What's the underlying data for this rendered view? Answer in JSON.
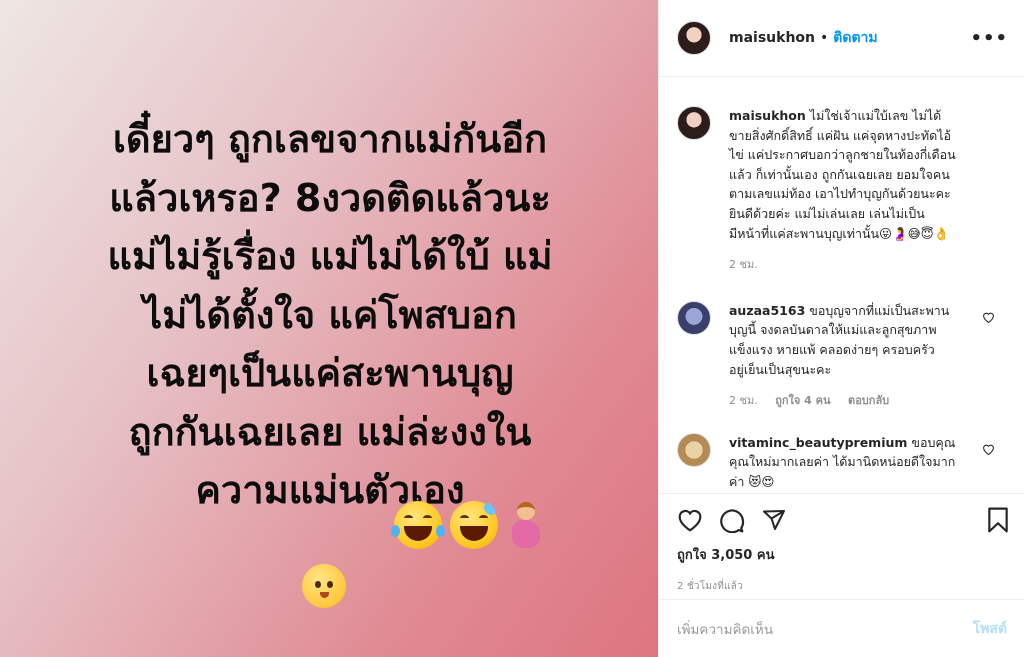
{
  "image": {
    "text": "เดี๋ยวๆ ถูกเลขจากแม่กันอีก\nแล้วเหรอ? 8งวดติดแล้วนะ\nแม่ไม่รู้เรื่อง แม่ไม่ได้ใบ้ แม่\nไม่ได้ตั้งใจ แค่โพสบอก\nเฉยๆเป็นแค่สะพานบุญ\nถูกกันเฉยเลย แม่ล่ะงงใน\nความแม่นตัวเอง",
    "emojis": [
      "face-with-tears-of-joy",
      "grinning-face-with-sweat",
      "pregnant-woman",
      "baby"
    ]
  },
  "header": {
    "username": "maisukhon",
    "separator": "•",
    "follow_label": "ติดตาม",
    "more_icon": "more-icon",
    "more_label": "•••"
  },
  "comments": [
    {
      "username": "maisukhon",
      "text": "ไม่ใช่เจ้าแม่ใบ้เลข ไม่ได้ขายสิ่งศักดิ์สิทธิ์ แค่ฝัน แค่จุดหางปะทัดไอ้ไข่ แค่ประกาศบอกว่าลูกชายในท้องกี่เดือนแล้ว ก็เท่านั้นเอง ถูกกันเฉยเลย ยอมใจคนตามเลขแม่ท้อง เอาไปทำบุญกันด้วยนะคะ ยินดีด้วยค่ะ แม่ไม่เล่นเลย เล่นไม่เป็น มีหน้าที่แค่สะพานบุญเท่านั้น😛🤰😅😇👌",
      "time": "2 ชม."
    },
    {
      "username": "auzaa5163",
      "text": "ขอบุญจากที่แม่เป็นสะพานบุญนี้ จงดลบันดาลให้แม่และลูกสุขภาพแข็งแรง หายแพ้ คลอดง่ายๆ ครอบครัวอยู่เย็นเป็นสุขนะคะ",
      "time": "2 ชม.",
      "likes": "ถูกใจ 4 คน",
      "reply": "ตอบกลับ"
    },
    {
      "username": "vitaminc_beautypremium",
      "text": "ขอบคุณคุณใหม่มากเลยค่า ได้มานิดหน่อยดีใจมากค่า 😻😍"
    }
  ],
  "actions": {
    "likes": "ถูกใจ 3,050 คน",
    "time": "2 ชั่วโมงที่แล้ว"
  },
  "add_comment": {
    "placeholder": "เพิ่มความคิดเห็น",
    "post_label": "โพสต์"
  },
  "colors": {
    "link": "#0095f6",
    "post_disabled": "#b2dffc",
    "muted": "#8e8e8e"
  }
}
